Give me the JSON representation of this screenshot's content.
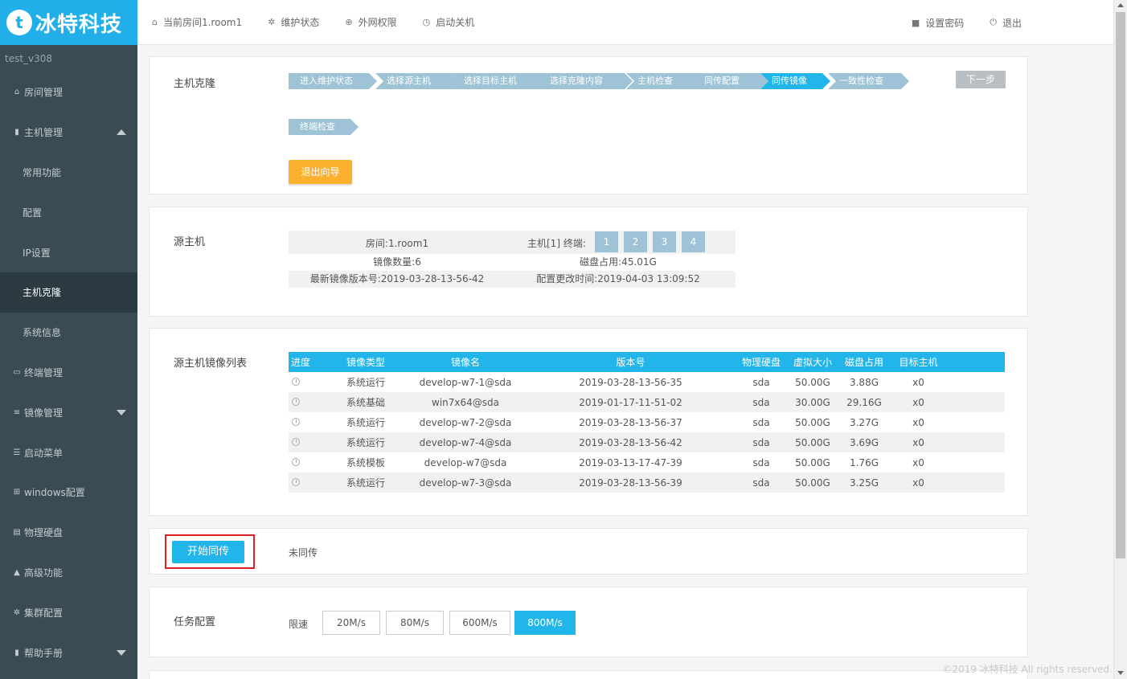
{
  "logo": {
    "mark": "t",
    "text": "冰特科技"
  },
  "version": "test_v308",
  "topbar": {
    "room": "当前房间1.room1",
    "maintenance": "维护状态",
    "network": "外网权限",
    "power": "启动关机",
    "set_password": "设置密码",
    "logout": "退出"
  },
  "sidebar": {
    "items": [
      {
        "icon": "home-icon",
        "glyph": "⌂",
        "label": "房间管理"
      },
      {
        "icon": "server-icon",
        "glyph": "▮",
        "label": "主机管理"
      },
      {
        "label": "常用功能"
      },
      {
        "label": "配置"
      },
      {
        "label": "IP设置"
      },
      {
        "label": "主机克隆"
      },
      {
        "label": "系统信息"
      },
      {
        "icon": "monitor-icon",
        "glyph": "▭",
        "label": "终端管理"
      },
      {
        "icon": "database-icon",
        "glyph": "≡",
        "label": "镜像管理"
      },
      {
        "icon": "list-icon",
        "glyph": "☰",
        "label": "启动菜单"
      },
      {
        "icon": "windows-icon",
        "glyph": "⊞",
        "label": "windows配置"
      },
      {
        "icon": "harddisk-icon",
        "glyph": "▤",
        "label": "物理硬盘"
      },
      {
        "icon": "warning-icon",
        "glyph": "▲",
        "label": "高级功能"
      },
      {
        "icon": "gear-icon",
        "glyph": "✲",
        "label": "集群配置"
      },
      {
        "icon": "book-icon",
        "glyph": "▮",
        "label": "帮助手册"
      }
    ]
  },
  "clone": {
    "label": "主机克隆",
    "steps": [
      "进入维护状态",
      "选择源主机",
      "选择目标主机",
      "选择克隆内容",
      "主机检查",
      "同传配置",
      "同传镜像",
      "一致性检查",
      "终端检查"
    ],
    "next": "下一步",
    "exit": "退出向导"
  },
  "source": {
    "label": "源主机",
    "room": "房间:1.room1",
    "host_terms": "主机[1]  终端:",
    "terminals": [
      "1",
      "2",
      "3",
      "4"
    ],
    "image_count": "镜像数量:6",
    "disk_usage": "磁盘占用:45.01G",
    "latest_version": "最新镜像版本号:2019-03-28-13-56-42",
    "config_time": "配置更改时间:2019-04-03 13:09:52"
  },
  "images": {
    "label": "源主机镜像列表",
    "columns": [
      "进度",
      "镜像类型",
      "镜像名",
      "版本号",
      "物理硬盘",
      "虚拟大小",
      "磁盘占用",
      "目标主机"
    ],
    "rows": [
      [
        "系统运行",
        "develop-w7-1@sda",
        "2019-03-28-13-56-35",
        "sda",
        "50.00G",
        "3.88G",
        "x0"
      ],
      [
        "系统基础",
        "win7x64@sda",
        "2019-01-17-11-51-02",
        "sda",
        "30.00G",
        "29.16G",
        "x0"
      ],
      [
        "系统运行",
        "develop-w7-2@sda",
        "2019-03-28-13-56-37",
        "sda",
        "50.00G",
        "3.27G",
        "x0"
      ],
      [
        "系统运行",
        "develop-w7-4@sda",
        "2019-03-28-13-56-42",
        "sda",
        "50.00G",
        "3.69G",
        "x0"
      ],
      [
        "系统模板",
        "develop-w7@sda",
        "2019-03-13-17-47-39",
        "sda",
        "50.00G",
        "1.76G",
        "x0"
      ],
      [
        "系统运行",
        "develop-w7-3@sda",
        "2019-03-28-13-56-39",
        "sda",
        "50.00G",
        "3.25G",
        "x0"
      ]
    ]
  },
  "sync": {
    "start": "开始同传",
    "status": "未同传"
  },
  "task": {
    "label": "任务配置",
    "limit": "限速",
    "speeds": [
      "20M/s",
      "80M/s",
      "600M/s",
      "800M/s"
    ],
    "selected": "800M/s"
  },
  "footer": "©2019 冰特科技 All rights reserved."
}
